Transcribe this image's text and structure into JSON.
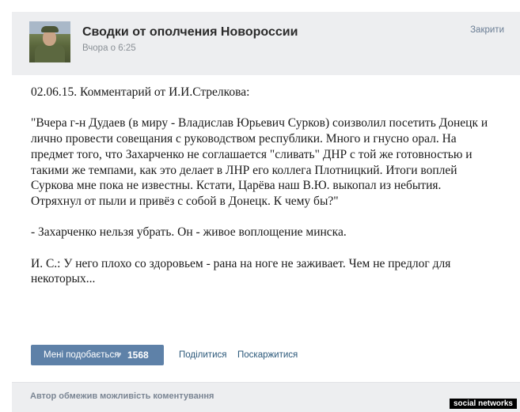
{
  "header": {
    "group_title": "Сводки от ополчения Новороссии",
    "time": "Вчора о 6:25",
    "close_label": "Закрити"
  },
  "post": {
    "paragraphs": [
      "02.06.15. Комментарий от И.И.Стрелкова:",
      "\"Вчера г-н Дудаев (в миру - Владислав Юрьевич Сурков) соизволил посетить Донецк и лично провести совещания с руководством республики. Много и гнусно орал. На предмет того, что Захарченко не соглашается \"сливать\" ДНР с той же готовностью и такими же темпами, как это делает в ЛНР его коллега Плотницкий. Итоги воплей Суркова мне пока не известны. Кстати, Царёва наш В.Ю. выкопал из небытия. Отряхнул от пыли и привёз с собой в Донецк. К чему бы?\"",
      "- Захарченко нельзя убрать. Он - живое воплощение минска.",
      "И. С.: У него плохо со здоровьем - рана на ноге не заживает. Чем не предлог для некоторых..."
    ]
  },
  "actions": {
    "like_label": "Мені подобається",
    "like_count": "1568",
    "share_label": "Поділитися",
    "report_label": "Поскаржитися"
  },
  "footer": {
    "comments_note": "Автор обмежив можливість коментування"
  },
  "watermark": "social networks",
  "colors": {
    "header_bg": "#edeef0",
    "like_button": "#5e81a8",
    "link": "#2b587a"
  },
  "icons": {
    "avatar": "avatar-photo",
    "like": "heart-icon"
  }
}
